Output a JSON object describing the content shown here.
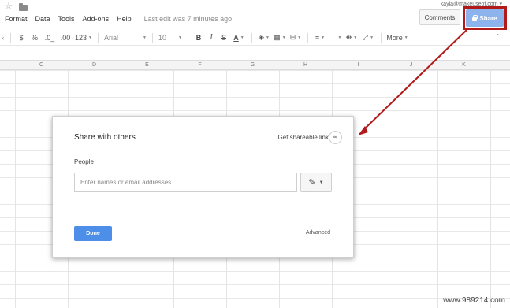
{
  "menubar": {
    "items": [
      "Format",
      "Data",
      "Tools",
      "Add-ons",
      "Help"
    ],
    "last_edit": "Last edit was 7 minutes ago"
  },
  "header": {
    "account": "kayla@makeuseof.com",
    "comments_label": "Comments",
    "share_label": "Share"
  },
  "toolbar": {
    "currency": "$",
    "percent": "%",
    "decimal_less": ".0_",
    "decimal_more": ".00",
    "number_format": "123",
    "font": "Arial",
    "font_size": "10",
    "bold": "B",
    "italic": "I",
    "strikethrough": "S",
    "text_color": "A",
    "more": "More"
  },
  "sheet": {
    "columns": [
      "C",
      "D",
      "E",
      "F",
      "G",
      "H",
      "I",
      "J",
      "K"
    ]
  },
  "dialog": {
    "title": "Share with others",
    "shareable_link": "Get shareable link",
    "people_label": "People",
    "people_placeholder": "Enter names or email addresses...",
    "done_label": "Done",
    "advanced_label": "Advanced"
  },
  "watermark": "www.989214.com",
  "colors": {
    "share_button": "#8db3ec",
    "done_button": "#4d8fe8",
    "highlight": "#b21a1a"
  }
}
